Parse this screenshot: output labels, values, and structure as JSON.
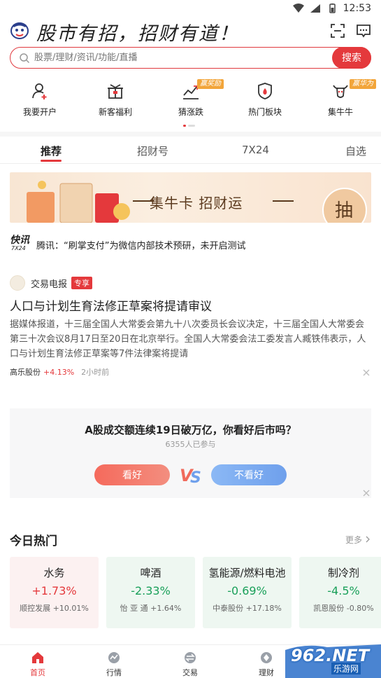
{
  "status_bar": {
    "time": "12:53"
  },
  "header": {
    "slogan": "股市有招，招财有道！"
  },
  "search": {
    "placeholder": "股票/理财/资讯/功能/直播",
    "button_label": "搜索"
  },
  "quick_nav": [
    {
      "label": "我要开户",
      "icon": "user-add-icon"
    },
    {
      "label": "新客福利",
      "icon": "gift-icon"
    },
    {
      "label": "猜涨跌",
      "icon": "trend-chart-icon",
      "badge": "赢奖励"
    },
    {
      "label": "热门板块",
      "icon": "shield-fire-icon"
    },
    {
      "label": "集牛牛",
      "icon": "bull-icon",
      "badge": "赢华为"
    }
  ],
  "tabs": [
    {
      "label": "推荐",
      "active": true
    },
    {
      "label": "招财号",
      "active": false
    },
    {
      "label": "7X24",
      "active": false
    },
    {
      "label": "自选",
      "active": false
    }
  ],
  "banner": {
    "text": "集牛卡 招财运",
    "button": "抽"
  },
  "flash": {
    "logo": "快讯",
    "logo_sub": "7X24",
    "text": "腾讯：“刷掌支付”为微信内部技术预研，未开启测试"
  },
  "article": {
    "source": "交易电报",
    "tag": "专享",
    "title": "人口与计划生育法修正草案将提请审议",
    "body": "据媒体报道，十三届全国人大常委会第九十八次委员长会议决定，十三届全国人大常委会第三十次会议8月17日至20日在北京举行。全国人大常委会法工委发言人臧铁伟表示，人口与计划生育法修正草案等7件法律案将提请",
    "stock": "高乐股份",
    "change": "+4.13%",
    "time": "2小时前"
  },
  "poll": {
    "question": "A股成交额连续19日破万亿，你看好后市吗？",
    "participants": "6355人已参与",
    "bull_label": "看好",
    "vs_label": "VS",
    "bear_label": "不看好"
  },
  "hot": {
    "title": "今日热门",
    "more": "更多",
    "cards": [
      {
        "name": "水务",
        "change": "+1.73%",
        "lead": "顺控发展 +10.01%",
        "direction": "up"
      },
      {
        "name": "啤酒",
        "change": "-2.33%",
        "lead": "怡 亚 通 +1.64%",
        "direction": "down"
      },
      {
        "name": "氢能源/燃料电池",
        "change": "-0.69%",
        "lead": "中泰股份 +17.18%",
        "direction": "down"
      },
      {
        "name": "制冷剂",
        "change": "-4.5%",
        "lead": "凯恩股份 -0.80%",
        "direction": "down"
      }
    ]
  },
  "bottom_nav": [
    {
      "label": "首页",
      "icon": "home-icon",
      "active": true
    },
    {
      "label": "行情",
      "icon": "market-icon",
      "active": false
    },
    {
      "label": "交易",
      "icon": "trade-icon",
      "active": false
    },
    {
      "label": "理财",
      "icon": "finance-icon",
      "active": false
    }
  ],
  "watermark": {
    "text": "962.NET",
    "sub": "乐游网"
  },
  "colors": {
    "accent": "#e4393c",
    "up": "#e4393c",
    "down": "#1aa05a",
    "bear_blue": "#6fa0ec"
  }
}
